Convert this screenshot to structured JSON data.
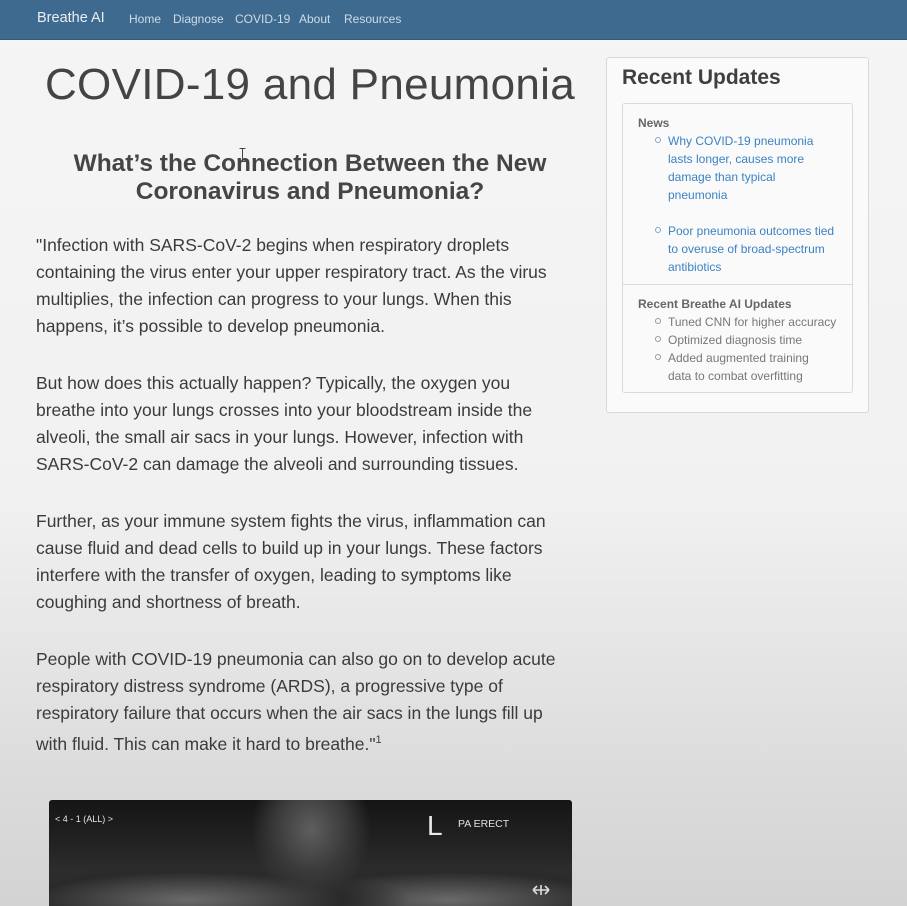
{
  "navbar": {
    "brand": "Breathe AI",
    "links": [
      "Home",
      "Diagnose",
      "COVID-19",
      "About",
      "Resources"
    ]
  },
  "main": {
    "title": "COVID-19 and Pneumonia",
    "subtitle_line1": "What’s the Connection Between the New",
    "subtitle_line2": "Coronavirus and Pneumonia?",
    "paragraphs": [
      {
        "lines": [
          "\"Infection with SARS-CoV-2 begins when respiratory droplets",
          "containing the virus enter your upper respiratory tract. As the virus",
          "multiplies, the infection can progress to your lungs. When this",
          "happens, it’s possible to develop pneumonia."
        ]
      },
      {
        "lines": [
          "But how does this actually happen? Typically, the oxygen you",
          "breathe into your lungs crosses into your bloodstream inside the",
          "alveoli, the small air sacs in your lungs. However, infection with",
          "SARS-CoV-2 can damage the alveoli and surrounding tissues."
        ]
      },
      {
        "lines": [
          "Further, as your immune system fights the virus, inflammation can",
          "cause fluid and dead cells to build up in your lungs. These factors",
          "interfere with the transfer of oxygen, leading to symptoms like",
          "coughing and shortness of breath."
        ]
      },
      {
        "lines": [
          "People with COVID-19 pneumonia can also go on to develop acute",
          "respiratory distress syndrome (ARDS), a progressive type of",
          "respiratory failure that occurs when the air sacs in the lungs fill up",
          "with fluid. This can make it hard to breathe.\""
        ],
        "footnote": "1"
      }
    ],
    "xray": {
      "label_left": "< 4 - 1 (ALL) >",
      "label_l": "L",
      "label_right": "PA ERECT"
    }
  },
  "sidebar": {
    "title": "Recent Updates",
    "news_heading": "News",
    "news_items": [
      {
        "lines": [
          "Why COVID-19 pneumonia",
          "lasts longer, causes more",
          "damage than typical",
          "pneumonia"
        ]
      },
      {
        "lines": [
          "Poor pneumonia outcomes tied",
          "to overuse of broad-spectrum",
          "antibiotics"
        ]
      }
    ],
    "ai_heading": "Recent Breathe AI Updates",
    "ai_items": [
      {
        "lines": [
          "Tuned CNN for higher accuracy"
        ]
      },
      {
        "lines": [
          "Optimized diagnosis time"
        ]
      },
      {
        "lines": [
          "Added augmented training",
          "data to combat overfitting"
        ]
      }
    ]
  },
  "colors": {
    "navbar": "#3f6a8f",
    "link": "#3b82c4"
  }
}
